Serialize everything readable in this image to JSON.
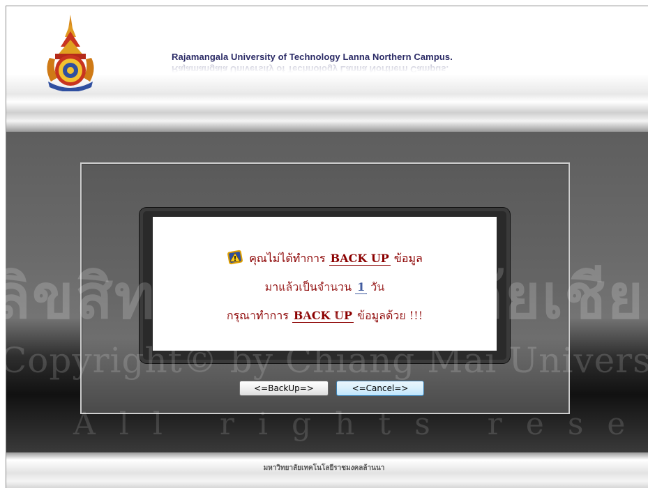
{
  "header": {
    "title": "Rajamangala University of Technology Lanna Northern Campus."
  },
  "dialog": {
    "line1_prefix": "คุณไม่ได้ทำการ ",
    "line1_em": "BACK UP",
    "line1_suffix": " ข้อมูล",
    "line2_prefix": "มาแล้วเป็นจำนวน ",
    "days": "1",
    "line2_suffix": " วัน",
    "line3_prefix": "กรุณาทำการ ",
    "line3_em": "BACK UP",
    "line3_suffix": " ข้อมูลด้วย !!!",
    "warning_icon": "warning-sign-icon"
  },
  "buttons": {
    "backup_label": "<=BackUp=>",
    "cancel_label": "<=Cancel=>"
  },
  "footer": {
    "text": "มหาวิทยาลัยเทคโนโลยีราชมงคลล้านนา"
  },
  "watermark": {
    "line1": "ลิขสิทธิ์มหาวิทยาลัยเชียงใหม่",
    "line2": "Copyright© by Chiang Mai University",
    "line3": "All rights reserved"
  },
  "colors": {
    "message_text": "#8b0000",
    "number_text": "#1a3a8b",
    "title_text": "#2b2b66"
  }
}
